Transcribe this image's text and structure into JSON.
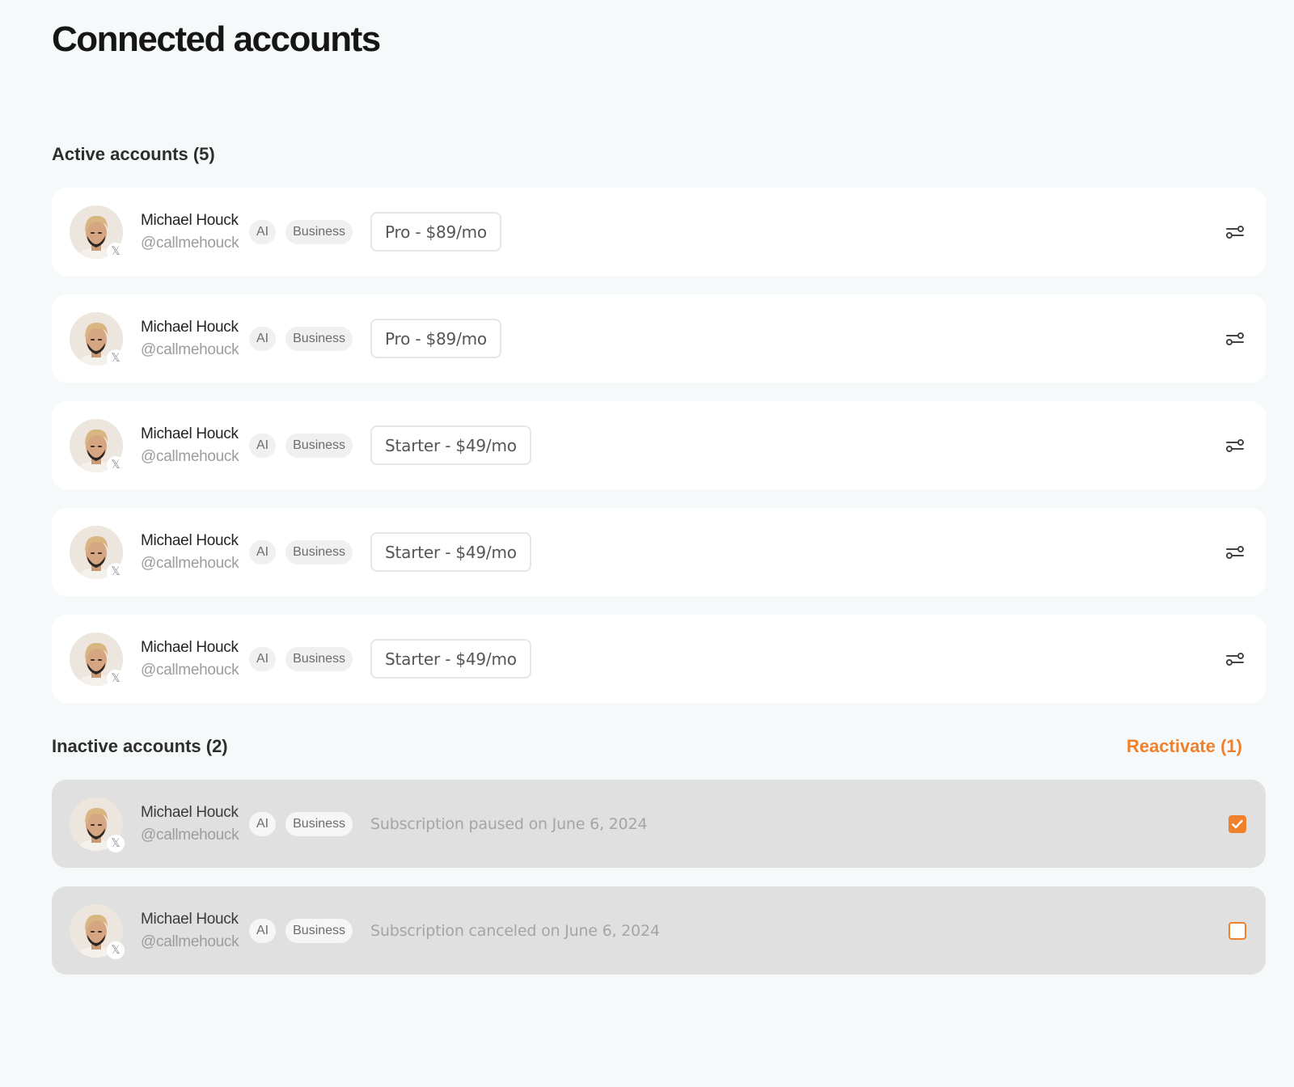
{
  "page": {
    "title": "Connected accounts"
  },
  "active": {
    "title": "Active accounts (5)",
    "accounts": [
      {
        "name": "Michael Houck",
        "handle": "@callmehouck",
        "tags": [
          "AI",
          "Business"
        ],
        "plan": "Pro - $89/mo"
      },
      {
        "name": "Michael Houck",
        "handle": "@callmehouck",
        "tags": [
          "AI",
          "Business"
        ],
        "plan": "Pro - $89/mo"
      },
      {
        "name": "Michael Houck",
        "handle": "@callmehouck",
        "tags": [
          "AI",
          "Business"
        ],
        "plan": "Starter - $49/mo"
      },
      {
        "name": "Michael Houck",
        "handle": "@callmehouck",
        "tags": [
          "AI",
          "Business"
        ],
        "plan": "Starter - $49/mo"
      },
      {
        "name": "Michael Houck",
        "handle": "@callmehouck",
        "tags": [
          "AI",
          "Business"
        ],
        "plan": "Starter - $49/mo"
      }
    ]
  },
  "inactive": {
    "title": "Inactive accounts (2)",
    "reactivate_label": "Reactivate (1)",
    "accounts": [
      {
        "name": "Michael Houck",
        "handle": "@callmehouck",
        "tags": [
          "AI",
          "Business"
        ],
        "status": "Subscription paused on June 6, 2024",
        "checked": true
      },
      {
        "name": "Michael Houck",
        "handle": "@callmehouck",
        "tags": [
          "AI",
          "Business"
        ],
        "status": "Subscription canceled on June 6, 2024",
        "checked": false
      }
    ]
  },
  "icons": {
    "platform_badge": "𝕏",
    "settings": "sliders-icon",
    "check": "check-icon"
  },
  "colors": {
    "accent": "#f0812c",
    "background": "#f6f9fa",
    "card": "#ffffff",
    "inactive_card": "#e0e0e0"
  }
}
